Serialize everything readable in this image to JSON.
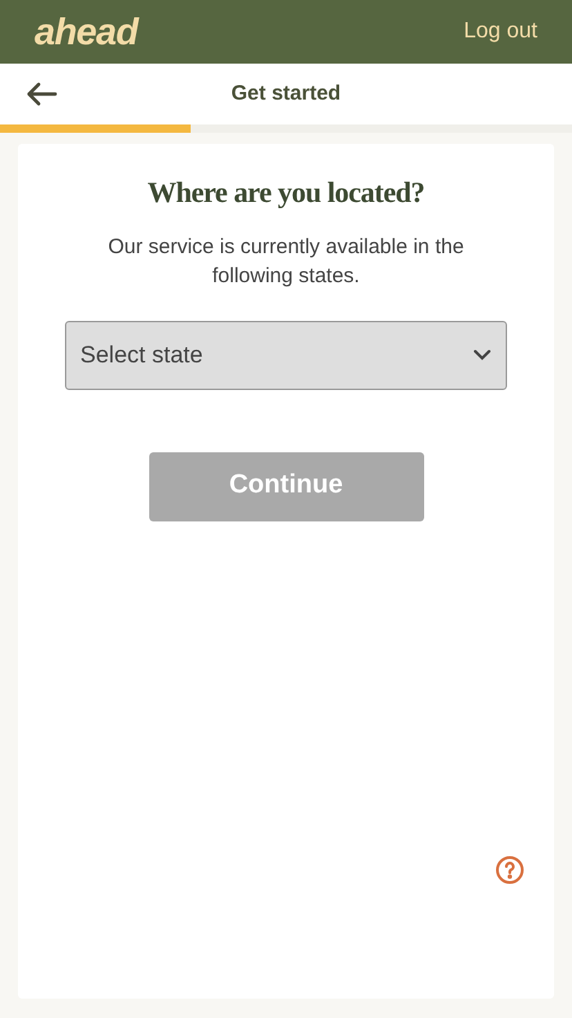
{
  "header": {
    "logo": "ahead",
    "logout": "Log out"
  },
  "nav": {
    "title": "Get started",
    "progress": {
      "level": 0.333
    }
  },
  "card": {
    "heading": "Where are you located?",
    "description": "Our service is currently available in the following states.",
    "state_select": {
      "placeholder": "Select state"
    },
    "continue_button": {
      "label": "Continue",
      "disabled": true
    }
  }
}
